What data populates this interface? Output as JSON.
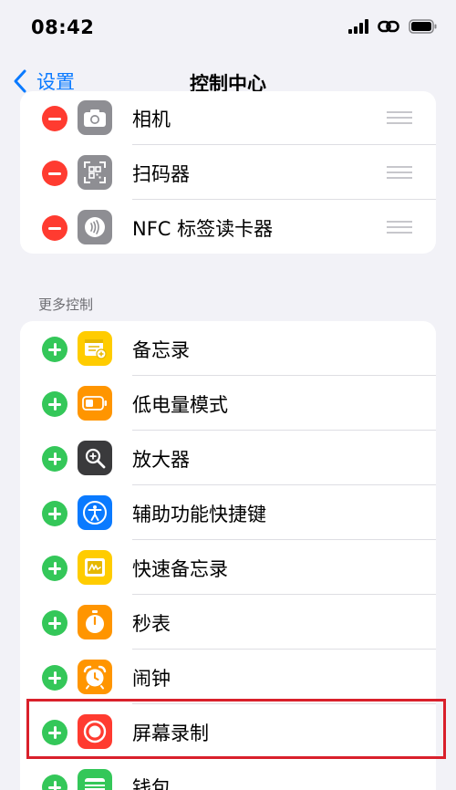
{
  "status": {
    "time": "08:42"
  },
  "nav": {
    "back_label": "设置",
    "title": "控制中心"
  },
  "included": [
    {
      "label": "相机",
      "icon": "camera-icon"
    },
    {
      "label": "扫码器",
      "icon": "qr-code-icon"
    },
    {
      "label": "NFC 标签读卡器",
      "icon": "nfc-icon"
    }
  ],
  "more_header": "更多控制",
  "more": [
    {
      "label": "备忘录",
      "icon": "notes-icon"
    },
    {
      "label": "低电量模式",
      "icon": "battery-icon"
    },
    {
      "label": "放大器",
      "icon": "magnifier-icon"
    },
    {
      "label": "辅助功能快捷键",
      "icon": "accessibility-icon"
    },
    {
      "label": "快速备忘录",
      "icon": "quick-note-icon"
    },
    {
      "label": "秒表",
      "icon": "stopwatch-icon"
    },
    {
      "label": "闹钟",
      "icon": "alarm-icon"
    },
    {
      "label": "屏幕录制",
      "icon": "screen-record-icon"
    },
    {
      "label": "钱包",
      "icon": "wallet-icon"
    }
  ],
  "colors": {
    "accent": "#0a7aff",
    "remove": "#ff3b30",
    "add": "#34c759",
    "highlight": "#d9202b"
  }
}
